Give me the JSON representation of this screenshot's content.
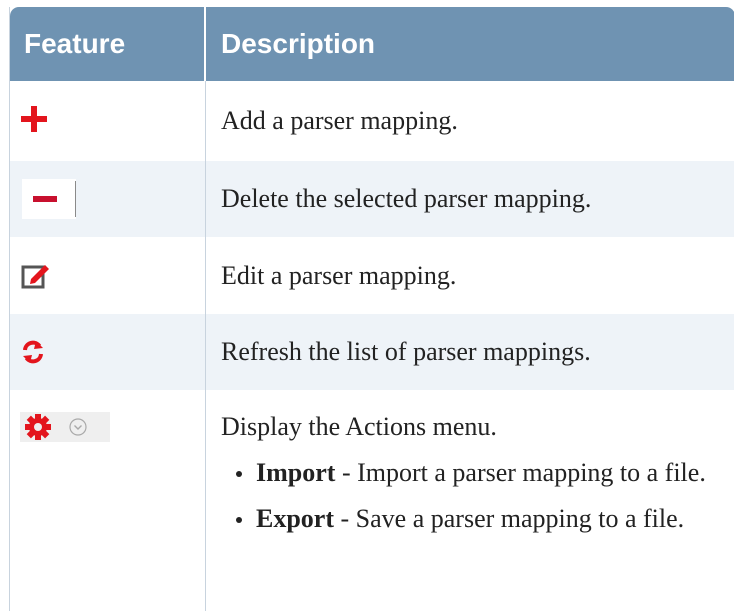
{
  "header": {
    "feature": "Feature",
    "description": "Description"
  },
  "rows": [
    {
      "icon": "plus-icon",
      "description": "Add a parser mapping."
    },
    {
      "icon": "minus-icon",
      "description": "Delete the selected parser mapping."
    },
    {
      "icon": "edit-icon",
      "description": "Edit a parser mapping."
    },
    {
      "icon": "refresh-icon",
      "description": "Refresh the list of parser mappings."
    },
    {
      "icon": "gear-icon",
      "secondary_icon": "chevron-down-icon",
      "description": "Display the Actions menu.",
      "items": [
        {
          "name": "Import",
          "separator": " - ",
          "text": "Import a parser mapping to a file."
        },
        {
          "name": "Export",
          "separator": " - ",
          "text": "Save a parser mapping to a file."
        }
      ]
    }
  ],
  "colors": {
    "header_bg": "#6f93b2",
    "row_shade": "#eef3f8",
    "icon_red": "#e3151d",
    "icon_gray": "#555555"
  }
}
